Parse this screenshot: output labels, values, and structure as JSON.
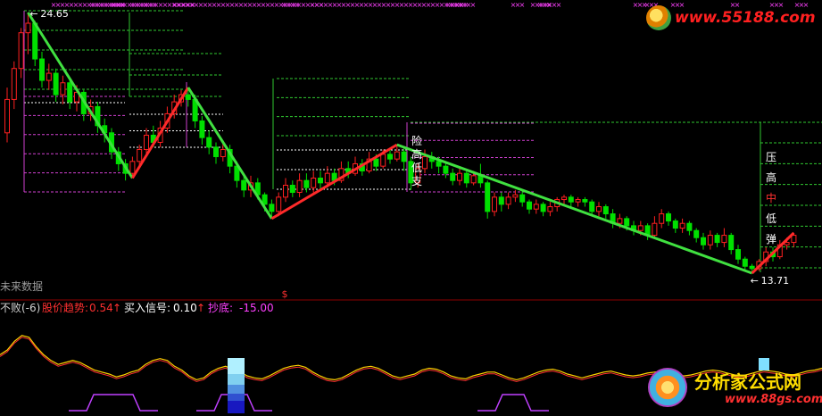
{
  "colors": {
    "background": "#000000",
    "candle_up": "#ff2020",
    "candle_down": "#00e000",
    "trend_down": "#40e040",
    "trend_up": "#ff2a2a",
    "resistance": "#30c830",
    "support": "#d040d0",
    "level_white": "#ffffff",
    "divider": "#8b0000",
    "osc_line_a": "#ffd000",
    "osc_line_b": "#ff3030",
    "osc_line_c": "#c040ff",
    "bar_cyan": "#80e0ff",
    "bar_blue": "#1818c0",
    "magenta": "#ff40ff"
  },
  "main_panel": {
    "price_high_label": "24.65",
    "price_low_label": "13.71",
    "future_data_label": "未来数据",
    "level_labels_left": [
      "险",
      "高",
      "低",
      "支"
    ],
    "level_labels_right": [
      "压",
      "高",
      "中",
      "低",
      "弹"
    ]
  },
  "indicator_panel": {
    "title": "不败(-6)",
    "items": [
      {
        "label": "股价趋势:",
        "value": "0.54",
        "arrow": "↑",
        "label_color": "#ff3030",
        "value_color": "#ff3030"
      },
      {
        "label": "买入信号:",
        "value": "0.10",
        "arrow": "↑",
        "label_color": "#ffffff",
        "value_color": "#ffffff"
      },
      {
        "label": "抄底:",
        "value": "-15.00",
        "arrow": "",
        "label_color": "#ff40ff",
        "value_color": "#ff40ff"
      }
    ]
  },
  "watermarks": {
    "top_right": "www.55188.com",
    "bottom_right_title": "分析家公式网",
    "bottom_right_url": "www.88gs.com"
  },
  "chart_data": {
    "type": "candlestick",
    "ylim": [
      13.71,
      24.65
    ],
    "highest_price": 24.65,
    "lowest_price": 13.71,
    "trend_segments": [
      {
        "direction": "down",
        "from_index": 3,
        "to_index": 18
      },
      {
        "direction": "up",
        "from_index": 18,
        "to_index": 26
      },
      {
        "direction": "down",
        "from_index": 26,
        "to_index": 38
      },
      {
        "direction": "up",
        "from_index": 38,
        "to_index": 56
      },
      {
        "direction": "down",
        "from_index": 56,
        "to_index": 107
      },
      {
        "direction": "up",
        "from_index": 107,
        "to_index": 113
      }
    ],
    "candles": [
      [
        19.6,
        21.0,
        21.5,
        19.2
      ],
      [
        21.0,
        22.3,
        22.6,
        20.6
      ],
      [
        22.3,
        23.8,
        24.0,
        21.9
      ],
      [
        23.8,
        24.2,
        24.65,
        22.9
      ],
      [
        24.2,
        22.7,
        24.3,
        22.4
      ],
      [
        22.7,
        21.8,
        23.0,
        21.5
      ],
      [
        21.8,
        22.1,
        22.5,
        21.4
      ],
      [
        22.1,
        21.2,
        22.3,
        20.9
      ],
      [
        21.2,
        21.7,
        22.0,
        20.8
      ],
      [
        21.7,
        20.9,
        21.9,
        20.6
      ],
      [
        20.9,
        21.3,
        21.6,
        20.5
      ],
      [
        21.3,
        20.4,
        21.4,
        20.1
      ],
      [
        20.4,
        20.7,
        21.0,
        20.1
      ],
      [
        20.7,
        19.9,
        20.9,
        19.6
      ],
      [
        19.9,
        19.6,
        20.2,
        19.2
      ],
      [
        19.6,
        18.8,
        19.8,
        18.5
      ],
      [
        18.8,
        18.3,
        19.0,
        18.0
      ],
      [
        18.3,
        17.9,
        18.5,
        17.6
      ],
      [
        17.9,
        18.4,
        18.6,
        17.7
      ],
      [
        18.4,
        18.9,
        19.1,
        18.2
      ],
      [
        18.9,
        19.5,
        19.8,
        18.7
      ],
      [
        19.5,
        19.2,
        19.9,
        19.0
      ],
      [
        19.2,
        19.8,
        20.1,
        19.0
      ],
      [
        19.8,
        20.4,
        20.7,
        19.6
      ],
      [
        20.4,
        20.9,
        21.2,
        20.2
      ],
      [
        20.9,
        21.2,
        21.4,
        20.7
      ],
      [
        21.2,
        21.0,
        21.5,
        20.7
      ],
      [
        21.0,
        20.1,
        21.2,
        19.8
      ],
      [
        20.1,
        19.4,
        20.3,
        19.1
      ],
      [
        19.4,
        19.0,
        19.7,
        18.7
      ],
      [
        19.0,
        18.6,
        19.2,
        18.3
      ],
      [
        18.6,
        18.9,
        19.2,
        18.4
      ],
      [
        18.9,
        18.2,
        19.1,
        17.9
      ],
      [
        18.2,
        17.6,
        18.4,
        17.3
      ],
      [
        17.6,
        17.2,
        17.9,
        16.9
      ],
      [
        17.2,
        17.5,
        17.8,
        16.9
      ],
      [
        17.5,
        17.0,
        17.7,
        16.8
      ],
      [
        17.0,
        16.6,
        17.1,
        16.3
      ],
      [
        16.6,
        16.3,
        16.8,
        16.0
      ],
      [
        16.3,
        16.9,
        17.1,
        16.1
      ],
      [
        16.9,
        17.4,
        17.7,
        16.7
      ],
      [
        17.4,
        17.1,
        17.6,
        16.9
      ],
      [
        17.1,
        17.6,
        17.9,
        16.9
      ],
      [
        17.6,
        17.3,
        17.9,
        17.1
      ],
      [
        17.3,
        17.7,
        18.0,
        17.1
      ],
      [
        17.7,
        17.5,
        18.0,
        17.2
      ],
      [
        17.5,
        17.9,
        18.2,
        17.3
      ],
      [
        17.9,
        17.6,
        18.1,
        17.4
      ],
      [
        17.6,
        18.1,
        18.4,
        17.5
      ],
      [
        18.1,
        17.9,
        18.4,
        17.7
      ],
      [
        17.9,
        18.3,
        18.6,
        17.8
      ],
      [
        18.3,
        18.0,
        18.5,
        17.8
      ],
      [
        18.0,
        18.5,
        18.8,
        17.9
      ],
      [
        18.5,
        18.2,
        18.7,
        18.0
      ],
      [
        18.2,
        18.7,
        18.9,
        18.1
      ],
      [
        18.7,
        18.5,
        18.9,
        18.3
      ],
      [
        18.5,
        18.8,
        19.1,
        18.4
      ],
      [
        18.8,
        18.4,
        19.0,
        18.0
      ],
      [
        18.4,
        17.5,
        18.6,
        17.2
      ],
      [
        17.5,
        18.1,
        18.3,
        17.3
      ],
      [
        18.1,
        18.6,
        18.9,
        17.9
      ],
      [
        18.6,
        18.4,
        18.8,
        18.1
      ],
      [
        18.4,
        18.2,
        18.6,
        17.9
      ],
      [
        18.2,
        17.9,
        18.4,
        17.7
      ],
      [
        17.9,
        17.6,
        18.1,
        17.4
      ],
      [
        17.6,
        17.9,
        18.1,
        17.4
      ],
      [
        17.9,
        17.5,
        18.0,
        17.3
      ],
      [
        17.5,
        17.8,
        18.0,
        17.4
      ],
      [
        17.8,
        17.5,
        18.3,
        17.3
      ],
      [
        17.5,
        16.3,
        17.6,
        16.0
      ],
      [
        16.3,
        16.9,
        17.1,
        16.1
      ],
      [
        16.9,
        16.6,
        17.1,
        16.3
      ],
      [
        16.6,
        16.9,
        17.1,
        16.4
      ],
      [
        16.9,
        17.0,
        17.2,
        16.7
      ],
      [
        17.0,
        16.7,
        17.2,
        16.5
      ],
      [
        16.7,
        16.4,
        16.8,
        16.2
      ],
      [
        16.4,
        16.6,
        16.8,
        16.2
      ],
      [
        16.6,
        16.3,
        16.7,
        16.1
      ],
      [
        16.3,
        16.5,
        16.7,
        16.1
      ],
      [
        16.5,
        16.8,
        16.9,
        16.3
      ],
      [
        16.8,
        16.9,
        17.0,
        16.6
      ],
      [
        16.9,
        16.7,
        17.0,
        16.5
      ],
      [
        16.7,
        16.8,
        16.9,
        16.5
      ],
      [
        16.8,
        16.7,
        16.9,
        16.5
      ],
      [
        16.7,
        16.3,
        16.8,
        16.1
      ],
      [
        16.3,
        16.5,
        16.7,
        16.1
      ],
      [
        16.5,
        16.2,
        16.6,
        16.0
      ],
      [
        16.2,
        15.8,
        16.4,
        15.6
      ],
      [
        15.8,
        16.0,
        16.2,
        15.6
      ],
      [
        16.0,
        15.7,
        16.1,
        15.5
      ],
      [
        15.7,
        15.5,
        15.9,
        15.3
      ],
      [
        15.5,
        15.7,
        15.9,
        15.3
      ],
      [
        15.7,
        15.3,
        15.8,
        15.1
      ],
      [
        15.3,
        15.8,
        16.1,
        15.2
      ],
      [
        15.8,
        16.2,
        16.4,
        15.6
      ],
      [
        16.2,
        15.9,
        16.3,
        15.7
      ],
      [
        15.9,
        15.6,
        16.0,
        15.4
      ],
      [
        15.6,
        15.8,
        16.0,
        15.4
      ],
      [
        15.8,
        15.5,
        15.9,
        15.3
      ],
      [
        15.5,
        15.2,
        15.6,
        15.0
      ],
      [
        15.2,
        14.9,
        15.4,
        14.7
      ],
      [
        14.9,
        15.3,
        15.5,
        14.7
      ],
      [
        15.3,
        15.0,
        15.4,
        14.8
      ],
      [
        15.0,
        15.3,
        15.6,
        14.8
      ],
      [
        15.3,
        14.7,
        15.4,
        14.5
      ],
      [
        14.7,
        14.3,
        14.9,
        14.1
      ],
      [
        14.3,
        14.0,
        14.4,
        13.8
      ],
      [
        14.0,
        13.9,
        14.1,
        13.71
      ],
      [
        13.9,
        14.2,
        14.3,
        13.8
      ],
      [
        14.2,
        14.6,
        14.8,
        14.0
      ],
      [
        14.6,
        14.4,
        14.8,
        14.2
      ],
      [
        14.4,
        14.9,
        15.1,
        14.3
      ],
      [
        14.9,
        15.0,
        15.2,
        14.7
      ],
      [
        15.0,
        15.3,
        15.4,
        14.8
      ]
    ],
    "oscillator": [
      58,
      63,
      72,
      78,
      76,
      66,
      58,
      52,
      48,
      50,
      52,
      50,
      46,
      42,
      40,
      38,
      35,
      37,
      40,
      42,
      48,
      52,
      54,
      52,
      46,
      42,
      36,
      32,
      34,
      40,
      44,
      46,
      43,
      40,
      36,
      34,
      33,
      36,
      40,
      44,
      46,
      47,
      45,
      40,
      36,
      33,
      32,
      34,
      38,
      42,
      45,
      46,
      44,
      40,
      36,
      34,
      36,
      38,
      42,
      44,
      43,
      40,
      36,
      34,
      33,
      36,
      38,
      40,
      40,
      37,
      34,
      32,
      34,
      37,
      40,
      42,
      43,
      41,
      38,
      36,
      34,
      36,
      38,
      40,
      41,
      39,
      37,
      36,
      37,
      39,
      40,
      41,
      40,
      38,
      36,
      37,
      39,
      41,
      42,
      41,
      39,
      37,
      36,
      38,
      40,
      42,
      41,
      40,
      38,
      37,
      39,
      41,
      42,
      44
    ]
  }
}
